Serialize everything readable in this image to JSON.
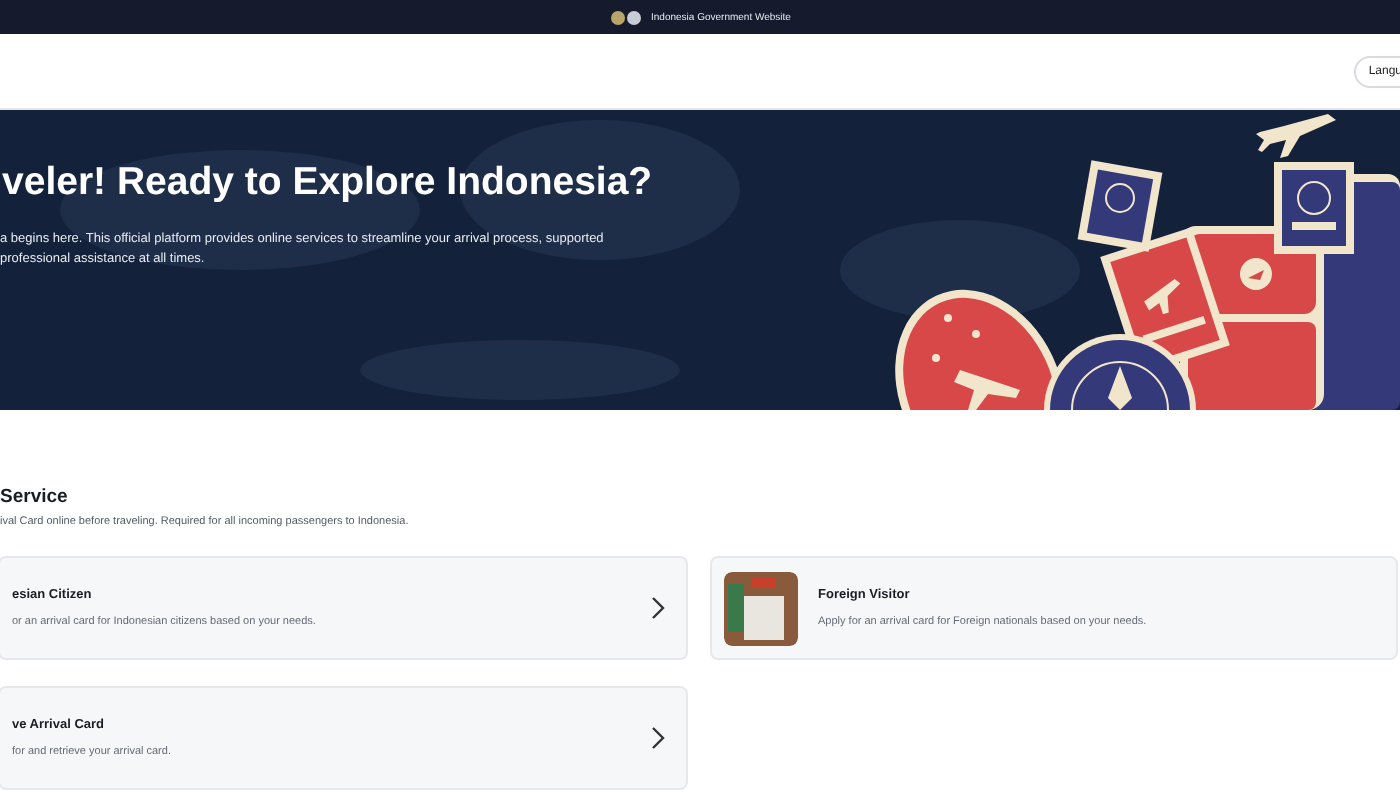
{
  "gov_bar": {
    "text": "Indonesia Government Website"
  },
  "header": {
    "language_button": "Langu"
  },
  "hero": {
    "title": "veler! Ready to Explore Indonesia?",
    "lines": [
      "a begins here. This official platform provides online services to streamline your arrival process, supported",
      "professional assistance at all times."
    ]
  },
  "service": {
    "title": "Service",
    "subtitle": "ival Card online before traveling. Required for all incoming passengers to Indonesia.",
    "cards": [
      {
        "kind": "chevron",
        "title": "esian Citizen",
        "description": "or an arrival card for Indonesian citizens based on your needs."
      },
      {
        "kind": "photo",
        "title": "Foreign Visitor",
        "description": "Apply for an arrival card for Foreign nationals based on your needs."
      },
      {
        "kind": "chevron",
        "title": "ve Arrival Card",
        "description": "for and retrieve your arrival card."
      }
    ]
  }
}
